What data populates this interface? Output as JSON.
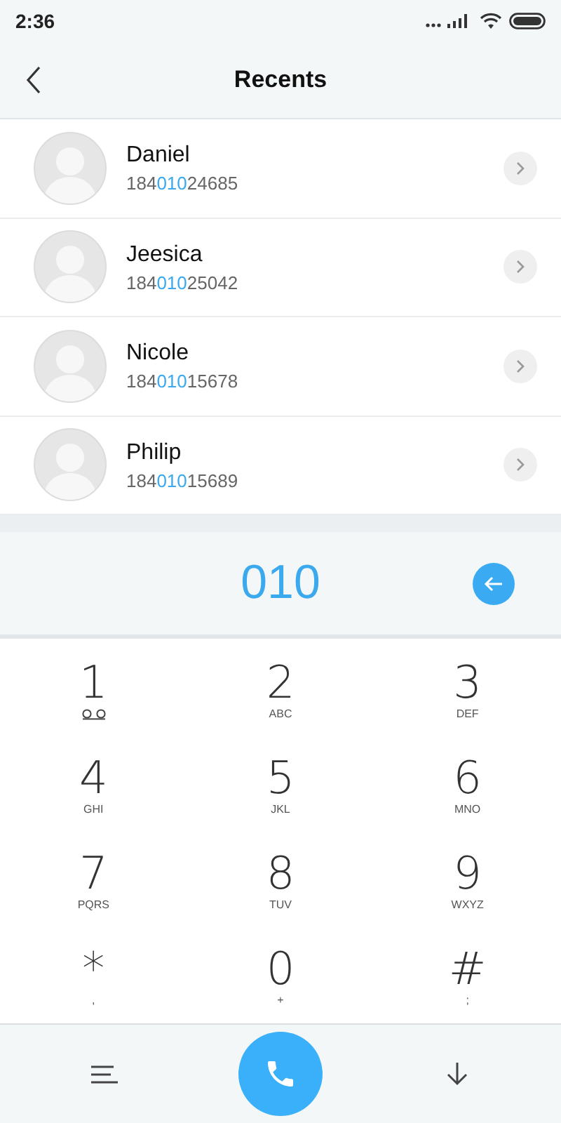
{
  "status_bar": {
    "time": "2:36"
  },
  "header": {
    "title": "Recents"
  },
  "recents": [
    {
      "name": "Daniel",
      "number": {
        "before": "184",
        "match": "010",
        "after": "24685"
      }
    },
    {
      "name": "Jeesica",
      "number": {
        "before": "184",
        "match": "010",
        "after": "25042"
      }
    },
    {
      "name": "Nicole",
      "number": {
        "before": "184",
        "match": "010",
        "after": "15678"
      }
    },
    {
      "name": "Philip",
      "number": {
        "before": "184",
        "match": "010",
        "after": "15689"
      }
    }
  ],
  "dialed": "010",
  "keypad": [
    {
      "digit": "1",
      "kind": "voicemail"
    },
    {
      "digit": "2",
      "kind": "letters",
      "letters": "ABC"
    },
    {
      "digit": "3",
      "kind": "letters",
      "letters": "DEF"
    },
    {
      "digit": "4",
      "kind": "letters",
      "letters": "GHI"
    },
    {
      "digit": "5",
      "kind": "letters",
      "letters": "JKL"
    },
    {
      "digit": "6",
      "kind": "letters",
      "letters": "MNO"
    },
    {
      "digit": "7",
      "kind": "letters",
      "letters": "PQRS"
    },
    {
      "digit": "8",
      "kind": "letters",
      "letters": "TUV"
    },
    {
      "digit": "9",
      "kind": "letters",
      "letters": "WXYZ"
    },
    {
      "digit": "*",
      "kind": "letters",
      "letters": ","
    },
    {
      "digit": "0",
      "kind": "letters",
      "letters": "+"
    },
    {
      "digit": "#",
      "kind": "letters",
      "letters": ";"
    }
  ]
}
